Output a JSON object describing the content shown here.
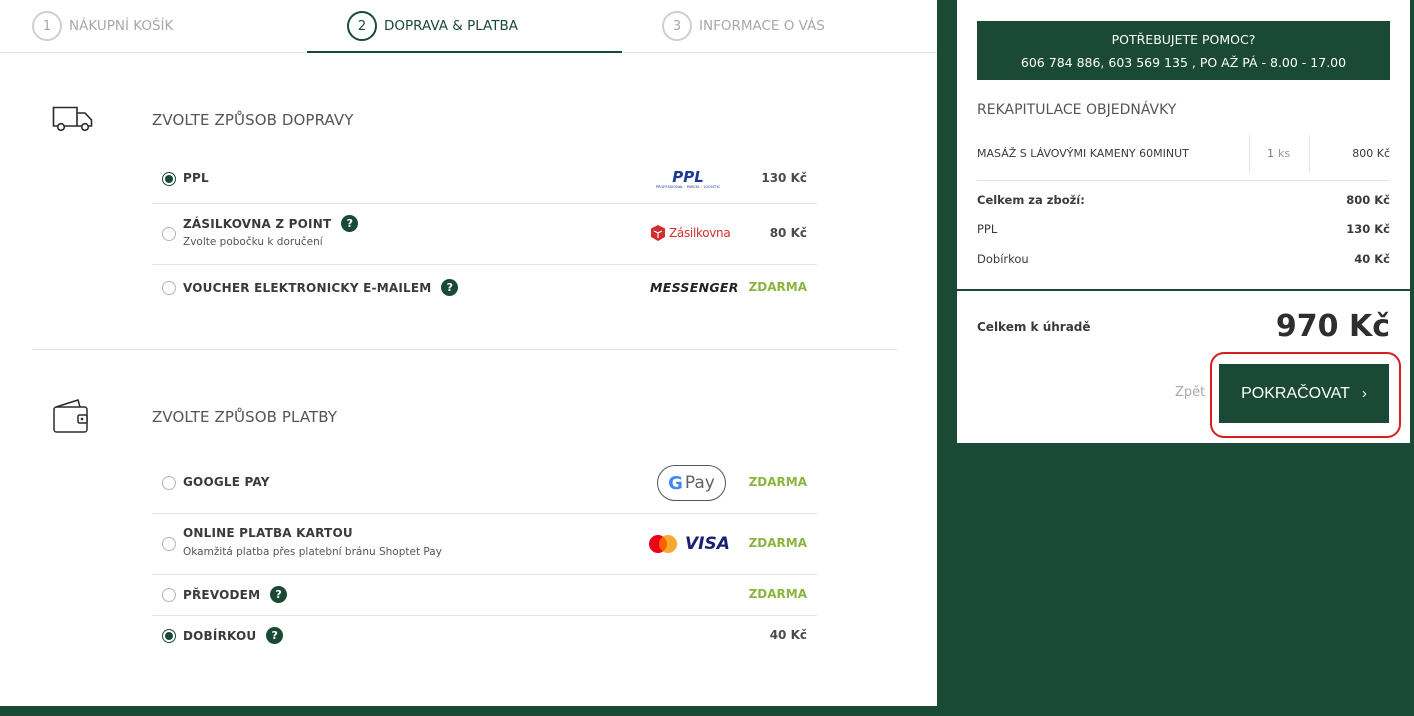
{
  "steps": [
    {
      "num": "1",
      "label": "NÁKUPNÍ KOŠÍK"
    },
    {
      "num": "2",
      "label": "DOPRAVA & PLATBA"
    },
    {
      "num": "3",
      "label": "INFORMACE O VÁS"
    }
  ],
  "shipping": {
    "title": "ZVOLTE ZPŮSOB DOPRAVY",
    "icon": "truck-icon",
    "options": [
      {
        "label": "PPL",
        "sub": "",
        "price": "130 Kč",
        "logo": "PPL",
        "logo_sub": "PROFESSIONAL · PARCEL · LOGISTIC",
        "checked": true
      },
      {
        "label": "ZÁSILKOVNA Z POINT",
        "sub": "Zvolte pobočku k doručení",
        "price": "80 Kč",
        "logo": "Zásilkovna",
        "checked": false
      },
      {
        "label": "VOUCHER ELEKTRONICKY E-MAILEM",
        "sub": "",
        "price": "ZDARMA",
        "logo": "MESSENGER",
        "checked": false
      }
    ]
  },
  "payment": {
    "title": "ZVOLTE ZPŮSOB PLATBY",
    "icon": "wallet-icon",
    "options": [
      {
        "label": "GOOGLE PAY",
        "sub": "",
        "price": "ZDARMA",
        "logo": "Pay",
        "checked": false
      },
      {
        "label": "ONLINE PLATBA KARTOU",
        "sub": "Okamžitá platba přes platební bránu Shoptet Pay",
        "price": "ZDARMA",
        "logo": "VISA",
        "checked": false
      },
      {
        "label": "PŘEVODEM",
        "sub": "",
        "price": "ZDARMA",
        "checked": false
      },
      {
        "label": "DOBÍRKOU",
        "sub": "",
        "price": "40 Kč",
        "checked": true
      }
    ]
  },
  "help_symbol": "?",
  "sidebar": {
    "help_title": "POTŘEBUJETE POMOC?",
    "help_contact": "606 784 886, 603 569 135 , PO AŽ PÁ - 8.00 - 17.00",
    "recap_title": "REKAPITULACE OBJEDNÁVKY",
    "item": {
      "name": "MASÁŽ S LÁVOVÝMI KAMENY 60MINUT",
      "qty": "1",
      "unit": "ks",
      "price": "800 Kč"
    },
    "summary": [
      {
        "label": "Celkem za zboží:",
        "value": "800 Kč"
      },
      {
        "label": "PPL",
        "value": "130 Kč"
      },
      {
        "label": "Dobírkou",
        "value": "40 Kč"
      }
    ],
    "total_label": "Celkem k úhradě",
    "total_value": "970 Kč",
    "back_label": "Zpět",
    "continue_label": "POKRAČOVAT",
    "continue_chevron": "›"
  },
  "colors": {
    "brand": "#1a4a36",
    "free": "#8cb53e",
    "highlight": "#d42020"
  }
}
